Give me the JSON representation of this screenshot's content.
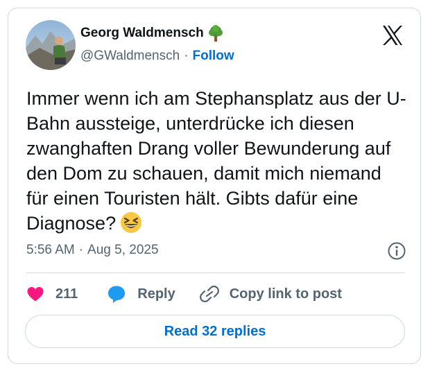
{
  "author": {
    "name": "Georg Waldmensch",
    "name_icon": "deciduous-tree-emoji",
    "handle": "@GWaldmensch",
    "separator": "·",
    "follow_label": "Follow"
  },
  "tweet": {
    "text": "Immer wenn ich am Stephansplatz aus der U-Bahn aussteige, unterdrücke ich diesen zwanghaften Drang voller Bewunderung auf den Dom zu schauen, damit mich niemand für einen Touristen hält. Gibts dafür eine Diagnose?",
    "trailing_emoji": "grinning-squinting-face-emoji",
    "time": "5:56 AM",
    "separator": "·",
    "date": "Aug 5, 2025"
  },
  "actions": {
    "like_count": "211",
    "reply_label": "Reply",
    "copy_link_label": "Copy link to post"
  },
  "read_replies_label": "Read 32 replies",
  "colors": {
    "like": "#f91880",
    "reply": "#1d9bf0",
    "follow": "#006fd6",
    "muted_text": "#536471",
    "border": "#cfd9de"
  }
}
